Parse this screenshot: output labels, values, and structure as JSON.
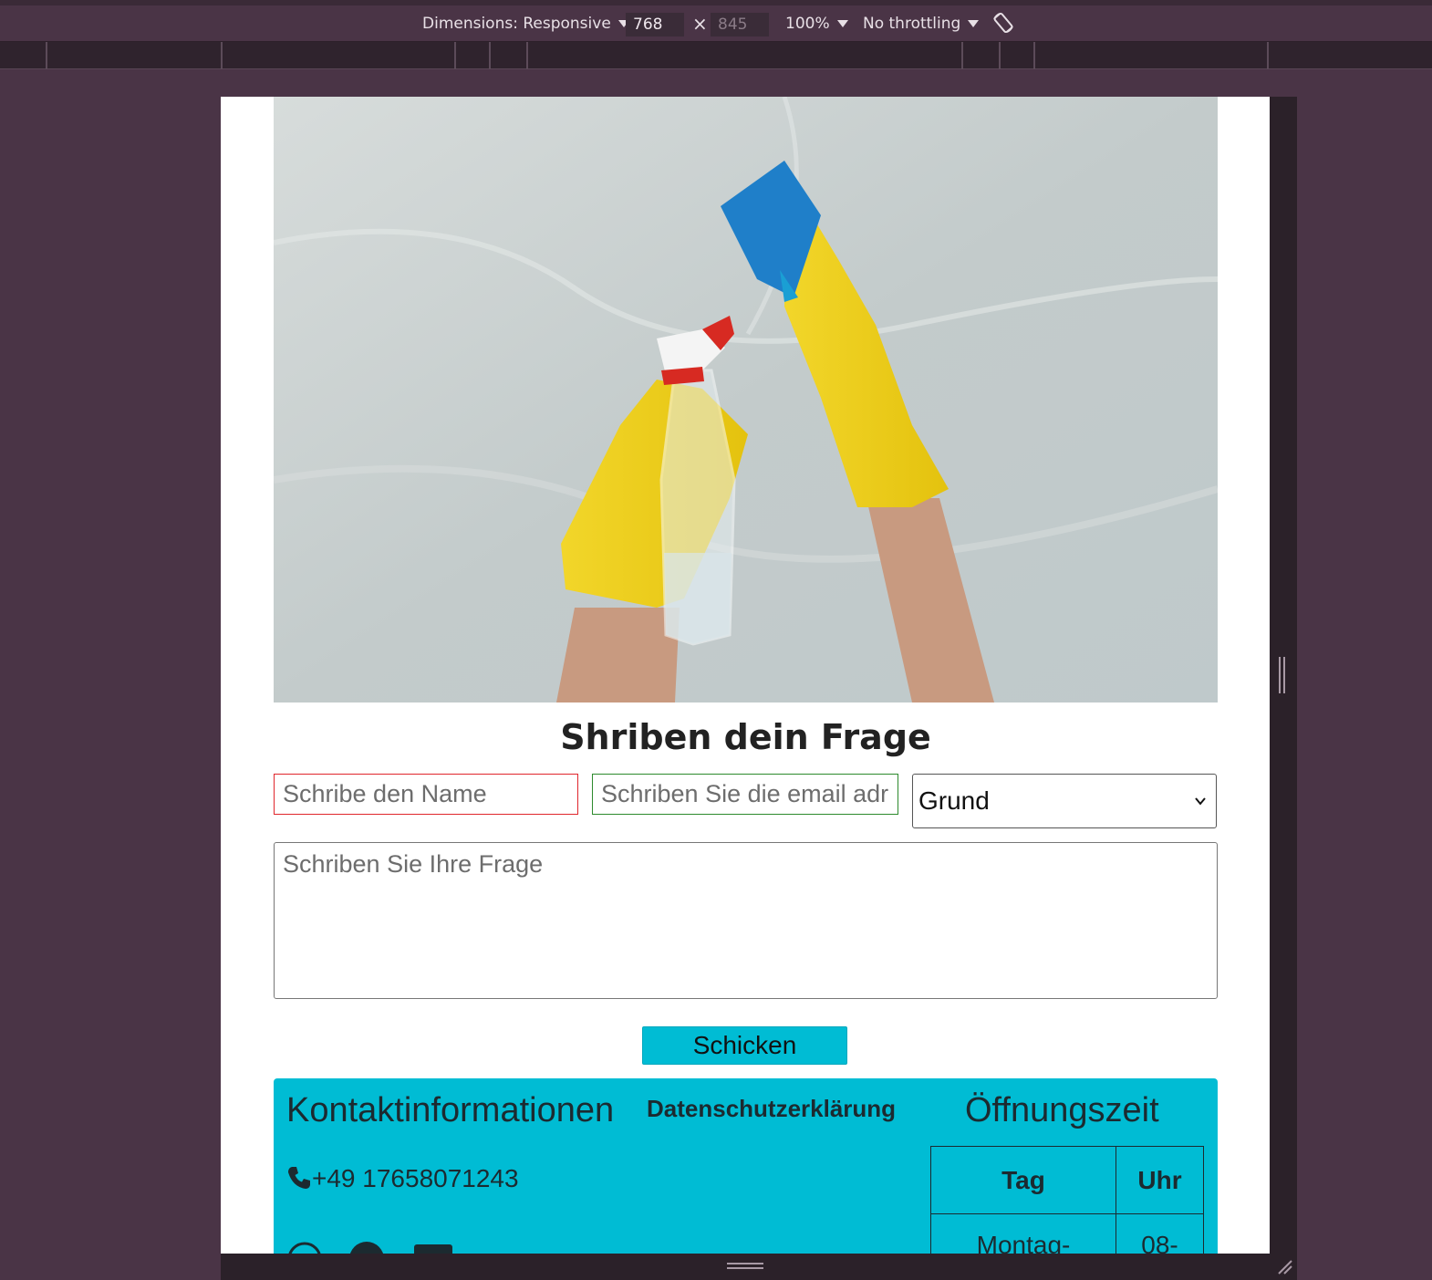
{
  "devtools": {
    "dimensions_label": "Dimensions: Responsive",
    "width_value": "768",
    "times": "×",
    "height_value": "845",
    "zoom_label": "100%",
    "throttling_label": "No throttling",
    "rotate_icon": "rotate-icon"
  },
  "page": {
    "hero_alt": "Gloved hands cleaning a wall with a spray bottle and sponge",
    "title": "Shriben dein Frage",
    "form": {
      "name_placeholder": "Schribe den Name",
      "email_placeholder": "Schriben Sie die email adr",
      "reason_selected": "Grund",
      "message_placeholder": "Schriben Sie Ihre Frage",
      "submit_label": "Schicken"
    },
    "footer": {
      "contact_heading": "Kontaktinformationen",
      "privacy_link": "Datenschutzerklärung",
      "hours_heading": "Öffnungszeit",
      "phone": "+49 17658071243",
      "phone_icon": "phone-icon",
      "hours_table": {
        "headers": [
          "Tag",
          "Uhr"
        ],
        "rows": [
          [
            "Montag-",
            "08-"
          ]
        ]
      },
      "social_icons": [
        "whatsapp-icon",
        "circle-icon",
        "email-icon"
      ]
    }
  },
  "colors": {
    "accent": "#00bcd4",
    "name_border": "#e0262c",
    "email_border": "#2d8a2d",
    "devtools_bg": "#4a3446"
  }
}
